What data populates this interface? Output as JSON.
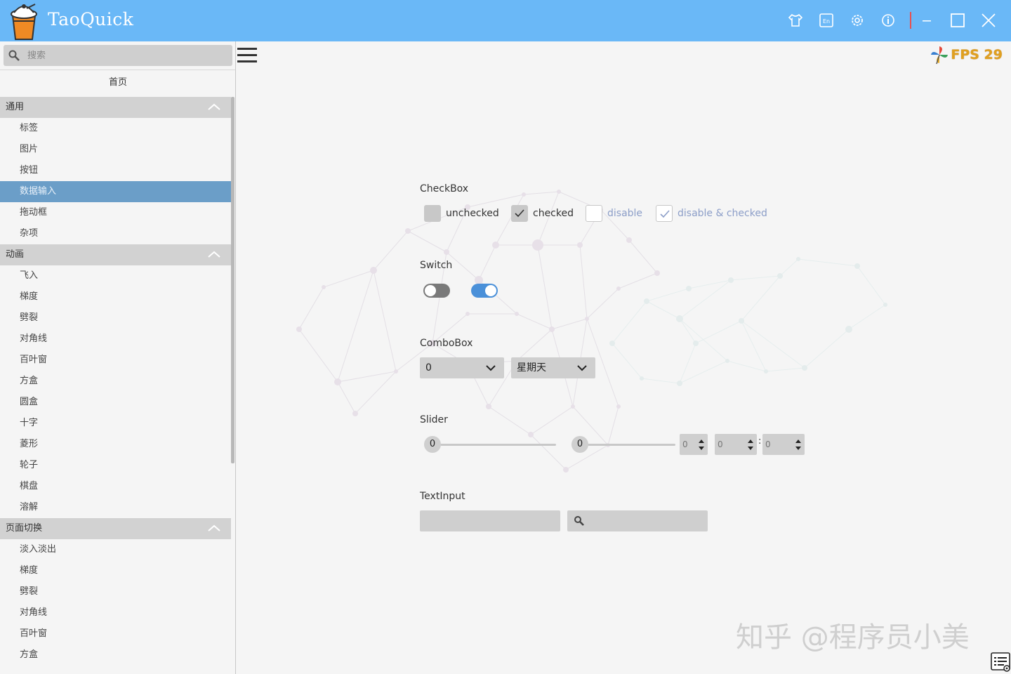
{
  "app": {
    "title": "TaoQuick"
  },
  "titlebar": {
    "buttons": [
      "skin-icon",
      "language-icon",
      "settings-icon",
      "about-icon",
      "minimize-icon",
      "maximize-icon",
      "close-icon"
    ]
  },
  "sidebar": {
    "search_placeholder": "搜索",
    "home": "首页",
    "groups": [
      {
        "title": "通用",
        "items": [
          "标签",
          "图片",
          "按钮",
          "数据输入",
          "拖动框",
          "杂项"
        ]
      },
      {
        "title": "动画",
        "items": [
          "飞入",
          "梯度",
          "劈裂",
          "对角线",
          "百叶窗",
          "方盒",
          "圆盒",
          "十字",
          "菱形",
          "轮子",
          "棋盘",
          "溶解"
        ]
      },
      {
        "title": "页面切换",
        "items": [
          "淡入淡出",
          "梯度",
          "劈裂",
          "对角线",
          "百叶窗",
          "方盒"
        ]
      }
    ],
    "active_item": "数据输入"
  },
  "main": {
    "fps_label": "FPS 29",
    "checkbox": {
      "title": "CheckBox",
      "items": [
        {
          "label": "unchecked",
          "checked": false,
          "disabled": false
        },
        {
          "label": "checked",
          "checked": true,
          "disabled": false
        },
        {
          "label": "disable",
          "checked": false,
          "disabled": true
        },
        {
          "label": "disable & checked",
          "checked": true,
          "disabled": true
        }
      ]
    },
    "switch": {
      "title": "Switch",
      "items": [
        {
          "on": false
        },
        {
          "on": true
        }
      ]
    },
    "combobox": {
      "title": "ComboBox",
      "first_value": "0",
      "second_value": "星期天"
    },
    "slider": {
      "title": "Slider",
      "first_value": "0",
      "second_value": "0",
      "spin1": "0",
      "spin2": "0",
      "spin3": "0",
      "separator": ":"
    },
    "textinput": {
      "title": "TextInput",
      "first_value": "",
      "second_value": ""
    }
  },
  "watermark": "知乎 @程序员小美",
  "colors": {
    "titlebar": "#6ab8f7",
    "active_item": "#6b9ec8",
    "group_header": "#d2d2d2",
    "switch_off": "#7a7a7a",
    "switch_on": "#4a90d9"
  }
}
